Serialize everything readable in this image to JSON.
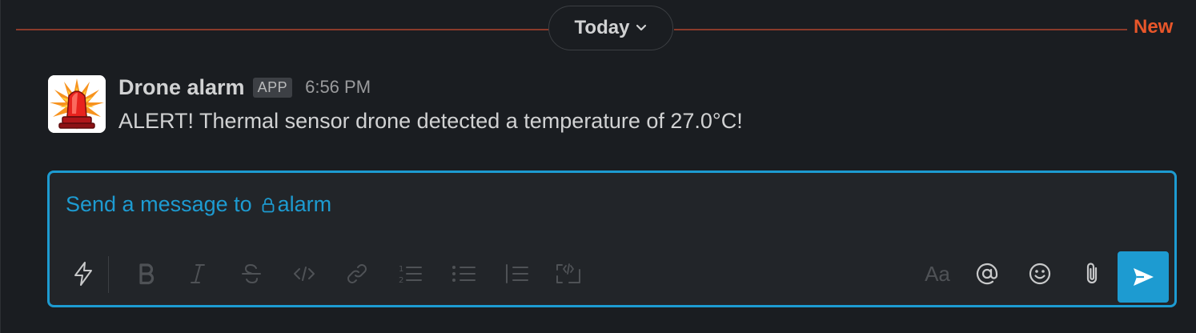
{
  "divider": {
    "date_label": "Today",
    "new_label": "New",
    "line_color": "#8a3a2a",
    "new_color": "#e8562a"
  },
  "message": {
    "sender": "Drone alarm",
    "badge": "APP",
    "time": "6:56 PM",
    "text": "ALERT! Thermal sensor drone detected a temperature of 27.0°C!",
    "avatar_icon": "siren-icon"
  },
  "composer": {
    "placeholder_prefix": "Send a message to",
    "channel": "alarm",
    "channel_icon": "lock-icon",
    "accent_color": "#1d9bd1",
    "toolbar": {
      "shortcuts": "lightning-icon",
      "bold": "bold-icon",
      "italic": "italic-icon",
      "strike": "strikethrough-icon",
      "code": "code-icon",
      "link": "link-icon",
      "ordered_list": "ordered-list-icon",
      "bulleted_list": "bulleted-list-icon",
      "blockquote": "blockquote-icon",
      "code_block": "code-block-icon",
      "formatting_label": "Aa",
      "mention": "at-icon",
      "emoji": "emoji-icon",
      "attach": "paperclip-icon",
      "send": "send-icon"
    }
  }
}
